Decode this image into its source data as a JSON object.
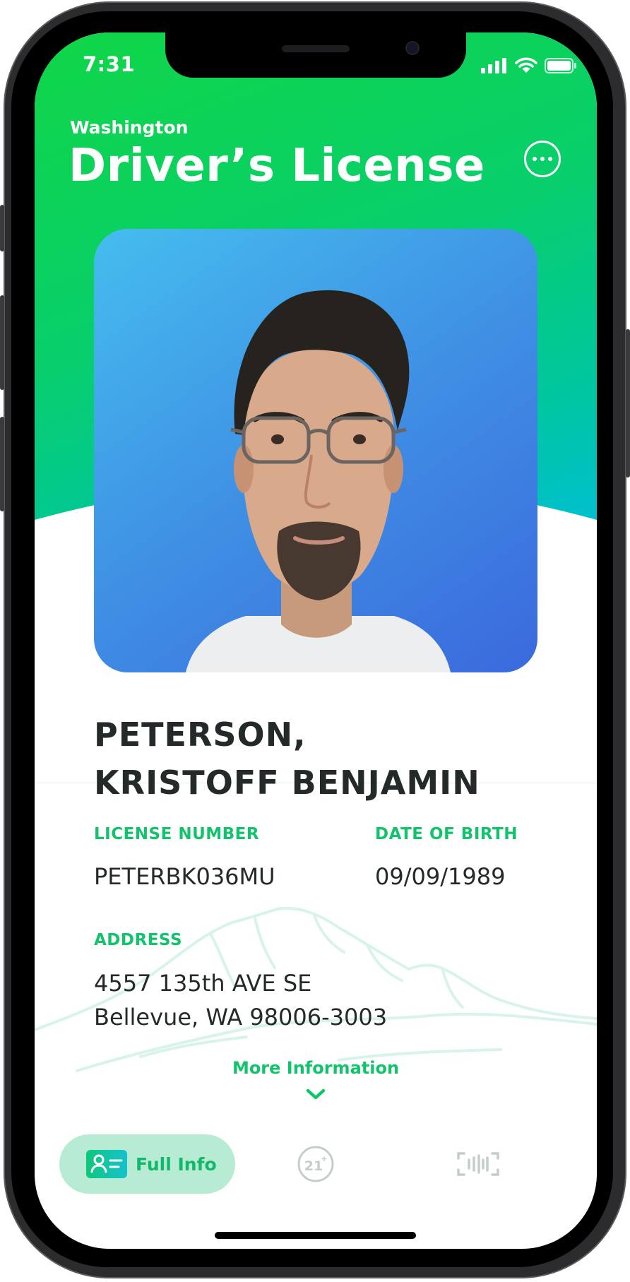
{
  "status_bar": {
    "time": "7:31"
  },
  "header": {
    "state": "Washington",
    "title": "Driver’s License",
    "menu_icon": "more-horizontal-icon"
  },
  "license": {
    "name_line1": "PETERSON,",
    "name_line2": "KRISTOFF BENJAMIN",
    "license_number_label": "LICENSE NUMBER",
    "license_number": "PETERBK036MU",
    "dob_label": "DATE OF BIRTH",
    "dob": "09/09/1989",
    "address_label": "ADDRESS",
    "address_line1": "4557 135th AVE SE",
    "address_line2": "Bellevue, WA 98006-3003"
  },
  "more_info": {
    "label": "More Information"
  },
  "tabs": [
    {
      "label": "Full Info",
      "icon": "id-card-icon",
      "active": true
    },
    {
      "label": "",
      "icon": "age-21-icon",
      "icon_text": "21+",
      "active": false
    },
    {
      "label": "",
      "icon": "barcode-scan-icon",
      "active": false
    }
  ],
  "colors": {
    "accent": "#11C36A",
    "hero_gradient_start": "#10D647",
    "hero_gradient_end": "#00BDE0",
    "photo_bg": "#3F90E4",
    "text": "#232A29"
  }
}
